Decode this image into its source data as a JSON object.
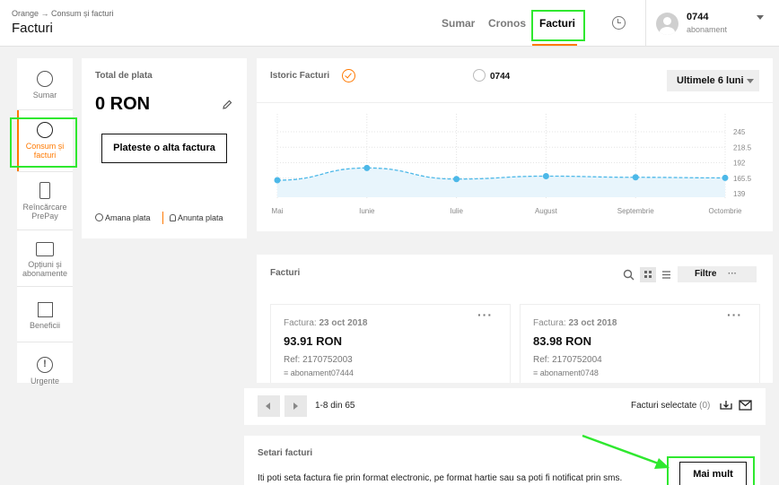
{
  "header": {
    "breadcrumb": "Orange → Consum și facturi",
    "title": "Facturi",
    "nav": [
      "Sumar",
      "Cronos",
      "Facturi"
    ],
    "user_number": "0744",
    "user_sub": "abonament"
  },
  "sidebar": {
    "items": [
      {
        "label": "Sumar",
        "icon": "user-circle-icon"
      },
      {
        "label": "Consum și facturi",
        "icon": "speedometer-icon"
      },
      {
        "label": "Reîncărcare PrePay",
        "icon": "phone-icon"
      },
      {
        "label": "Opțiuni și abonamente",
        "icon": "briefcase-icon"
      },
      {
        "label": "Beneficii",
        "icon": "gift-icon"
      },
      {
        "label": "Urgente",
        "icon": "alert-icon"
      }
    ]
  },
  "total": {
    "heading": "Total de plata",
    "amount": "0 RON",
    "pay_button": "Plateste o alta factura",
    "postpone": "Amana plata",
    "notify": "Anunta plata"
  },
  "history": {
    "heading": "Istoric Facturi",
    "line_label": "0744",
    "period": "Ultimele 6 luni"
  },
  "chart_data": {
    "type": "line",
    "title": "Istoric Facturi",
    "categories": [
      "Mai",
      "Iunie",
      "Iulie",
      "August",
      "Septembrie",
      "Octombrie"
    ],
    "y_ticks": [
      "245",
      "218.5",
      "192",
      "165.5",
      "139"
    ],
    "ylim": [
      139,
      245
    ],
    "values": [
      162,
      183,
      164,
      169,
      167,
      166
    ],
    "line_color": "#4cb8e8",
    "grid": true
  },
  "facturi": {
    "heading": "Facturi",
    "filter_label": "Filtre",
    "invoices": [
      {
        "label": "Factura:",
        "date": "23 oct 2018",
        "amount": "93.91 RON",
        "ref": "Ref: 2170752003",
        "account": "abonament07444"
      },
      {
        "label": "Factura:",
        "date": "23 oct 2018",
        "amount": "83.98 RON",
        "ref": "Ref: 2170752004",
        "account": "abonament0748"
      }
    ]
  },
  "pagination": {
    "range": "1-8 din 65",
    "selected_label": "Facturi selectate",
    "selected_count": "(0)"
  },
  "settings": {
    "heading": "Setari facturi",
    "text": "Iti poti seta factura fie prin format electronic, pe format hartie sau sa poti fi notificat prin sms.",
    "more_button": "Mai mult"
  },
  "colors": {
    "accent": "#ff7900",
    "highlight": "#2fe82f",
    "chart_line": "#4cb8e8"
  }
}
